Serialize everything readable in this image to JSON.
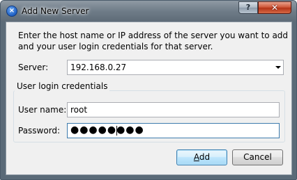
{
  "window": {
    "title": "Add New Server",
    "help_label": "?",
    "close_label": "✕",
    "app_icon": "x-logo-icon"
  },
  "intro": {
    "line1": "Enter the host name or IP address of the server you want to add",
    "line2": "and your user login credentials for that server."
  },
  "server": {
    "label": "Server:",
    "value": "192.168.0.27"
  },
  "credentials": {
    "group_title": "User login credentials",
    "username_label": "User name:",
    "username_value": "root",
    "password_label": "Password:",
    "password_masked": "●●●●●●●●"
  },
  "buttons": {
    "add_mnemonic": "A",
    "add_rest": "dd",
    "cancel": "Cancel"
  }
}
